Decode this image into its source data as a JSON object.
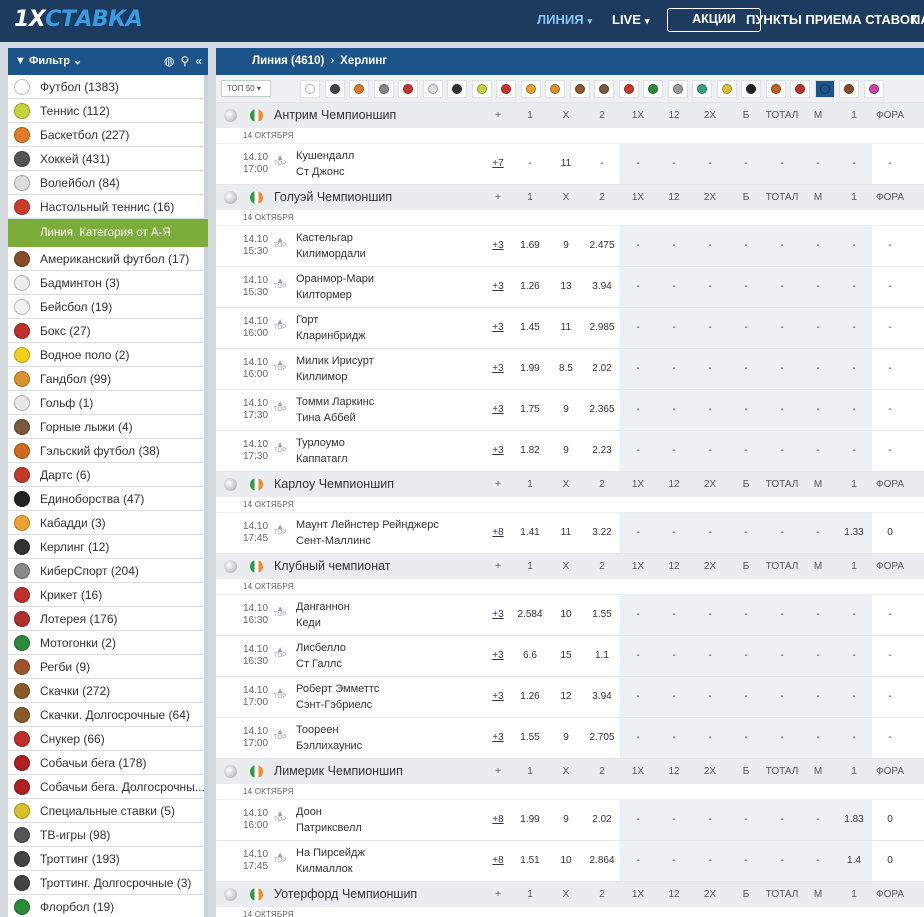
{
  "header": {
    "logo_part1": "1X",
    "logo_part2": "СТАВКА",
    "nav": [
      {
        "label": "ЛИНИЯ",
        "chevron": "▾",
        "active": true
      },
      {
        "label": "LIVE",
        "chevron": "▾",
        "active": false
      }
    ],
    "promo_label": "АКЦИИ",
    "points_label": "ПУНКТЫ ПРИЕМА СТАВОК",
    "cut_label": "ПА"
  },
  "sidebar": {
    "filter_label": "Фильтр",
    "category_label": "Линия. Категория от А-Я",
    "top_sports": [
      {
        "label": "Футбол (1383)",
        "icon": "football-icon",
        "color": "#ffffff"
      },
      {
        "label": "Теннис (112)",
        "icon": "tennis-icon",
        "color": "#c5d43a"
      },
      {
        "label": "Баскетбол (227)",
        "icon": "basketball-icon",
        "color": "#e07b2a"
      },
      {
        "label": "Хоккей (431)",
        "icon": "hockey-icon",
        "color": "#555555"
      },
      {
        "label": "Волейбол (84)",
        "icon": "volleyball-icon",
        "color": "#dddddd"
      },
      {
        "label": "Настольный теннис (16)",
        "icon": "table-tennis-icon",
        "color": "#d03a2a"
      }
    ],
    "sports": [
      {
        "label": "Американский футбол (17)",
        "icon": "american-football-icon",
        "color": "#8a4a26"
      },
      {
        "label": "Бадминтон (3)",
        "icon": "badminton-icon",
        "color": "#eeeeee"
      },
      {
        "label": "Бейсбол (19)",
        "icon": "baseball-icon",
        "color": "#f2f2f2"
      },
      {
        "label": "Бокс (27)",
        "icon": "boxing-icon",
        "color": "#c0302a"
      },
      {
        "label": "Водное поло (2)",
        "icon": "water-polo-icon",
        "color": "#f2d11a"
      },
      {
        "label": "Гандбол (99)",
        "icon": "handball-icon",
        "color": "#d8922e"
      },
      {
        "label": "Гольф (1)",
        "icon": "golf-icon",
        "color": "#e8e8e8"
      },
      {
        "label": "Горные лыжи (4)",
        "icon": "alpine-skiing-icon",
        "color": "#7a5a3a"
      },
      {
        "label": "Гэльский футбол (38)",
        "icon": "gaelic-football-icon",
        "color": "#d06a1e"
      },
      {
        "label": "Дартс (6)",
        "icon": "darts-icon",
        "color": "#c33a2a"
      },
      {
        "label": "Единоборства (47)",
        "icon": "martial-arts-icon",
        "color": "#222222"
      },
      {
        "label": "Кабадди (3)",
        "icon": "kabaddi-icon",
        "color": "#f0a030"
      },
      {
        "label": "Керлинг (12)",
        "icon": "curling-icon",
        "color": "#333333"
      },
      {
        "label": "КиберСпорт (204)",
        "icon": "esports-icon",
        "color": "#888888"
      },
      {
        "label": "Крикет (16)",
        "icon": "cricket-icon",
        "color": "#c0302a"
      },
      {
        "label": "Лотерея (176)",
        "icon": "lottery-icon",
        "color": "#b03030"
      },
      {
        "label": "Мотогонки (2)",
        "icon": "motorsport-icon",
        "color": "#2a8a3a"
      },
      {
        "label": "Регби (9)",
        "icon": "rugby-icon",
        "color": "#a0522d"
      },
      {
        "label": "Скачки (272)",
        "icon": "horse-racing-icon",
        "color": "#8a5a2a"
      },
      {
        "label": "Скачки. Долгосрочные (64)",
        "icon": "horse-racing-long-icon",
        "color": "#8a5a2a"
      },
      {
        "label": "Снукер (66)",
        "icon": "snooker-icon",
        "color": "#c0302a"
      },
      {
        "label": "Собачьи бега (178)",
        "icon": "greyhound-icon",
        "color": "#b02020"
      },
      {
        "label": "Собачьи бега. Долгосрочны...",
        "icon": "greyhound-long-icon",
        "color": "#b02020"
      },
      {
        "label": "Специальные ставки (5)",
        "icon": "special-bets-icon",
        "color": "#d8c02a"
      },
      {
        "label": "ТВ-игры (98)",
        "icon": "tv-games-icon",
        "color": "#555555"
      },
      {
        "label": "Троттинг (193)",
        "icon": "trotting-icon",
        "color": "#444444"
      },
      {
        "label": "Троттинг. Долгосрочные (3)",
        "icon": "trotting-long-icon",
        "color": "#444444"
      },
      {
        "label": "Флорбол (19)",
        "icon": "floorball-icon",
        "color": "#2a8a3a"
      }
    ]
  },
  "main": {
    "breadcrumb": [
      "Линия (4610)",
      "Херлинг"
    ],
    "breadcrumb_sep": "›",
    "top50_label": "ТОП 50 ▾",
    "tab_colors": [
      "#ffffff",
      "#444444",
      "#e07b2a",
      "#888888",
      "#cc3333",
      "#dddddd",
      "#333333",
      "#c5d43a",
      "#d0302a",
      "#e8a030",
      "#d8922e",
      "#8a5a2a",
      "#7a5a3a",
      "#c33a2a",
      "#2a8a3a",
      "#999999",
      "#3aa07a",
      "#d8c02a",
      "#222222",
      "#c06020",
      "#c0302a",
      "#1c5489",
      "#8a4a26",
      "#cc44aa"
    ],
    "columns": [
      "+",
      "1",
      "X",
      "2",
      "1X",
      "12",
      "2X",
      "Б",
      "ТОТАЛ",
      "М",
      "1",
      "ФОРА"
    ],
    "top_label": "TOP",
    "championships": [
      {
        "name": "Антрим Чемпионшип",
        "date": "14 ОКТЯБРЯ",
        "matches": [
          {
            "date": "14.10",
            "time": "17:00",
            "team1": "Кушендалл",
            "team2": "Ст Джонс",
            "more": "+7",
            "odds": [
              "-",
              "11",
              "-",
              "-",
              "-",
              "-",
              "-",
              "-",
              "-",
              "-",
              "-"
            ]
          }
        ]
      },
      {
        "name": "Голуэй Чемпионшип",
        "date": "14 ОКТЯБРЯ",
        "matches": [
          {
            "date": "14.10",
            "time": "15:30",
            "team1": "Кастельгар",
            "team2": "Килимордали",
            "more": "+3",
            "odds": [
              "1.69",
              "9",
              "2.475",
              "-",
              "-",
              "-",
              "-",
              "-",
              "-",
              "-",
              "-"
            ]
          },
          {
            "date": "14.10",
            "time": "15:30",
            "team1": "Оранмор-Мари",
            "team2": "Килтормер",
            "more": "+3",
            "odds": [
              "1.26",
              "13",
              "3.94",
              "-",
              "-",
              "-",
              "-",
              "-",
              "-",
              "-",
              "-"
            ]
          },
          {
            "date": "14.10",
            "time": "16:00",
            "team1": "Горт",
            "team2": "Кларинбридж",
            "more": "+3",
            "odds": [
              "1.45",
              "11",
              "2.985",
              "-",
              "-",
              "-",
              "-",
              "-",
              "-",
              "-",
              "-"
            ]
          },
          {
            "date": "14.10",
            "time": "16:00",
            "team1": "Милик Ирисурт",
            "team2": "Киллимор",
            "more": "+3",
            "odds": [
              "1.99",
              "8.5",
              "2.02",
              "-",
              "-",
              "-",
              "-",
              "-",
              "-",
              "-",
              "-"
            ]
          },
          {
            "date": "14.10",
            "time": "17:30",
            "team1": "Томми Ларкинс",
            "team2": "Тина Аббей",
            "more": "+3",
            "odds": [
              "1.75",
              "9",
              "2.365",
              "-",
              "-",
              "-",
              "-",
              "-",
              "-",
              "-",
              "-"
            ]
          },
          {
            "date": "14.10",
            "time": "17:30",
            "team1": "Турлоумо",
            "team2": "Каппатагл",
            "more": "+3",
            "odds": [
              "1.82",
              "9",
              "2.23",
              "-",
              "-",
              "-",
              "-",
              "-",
              "-",
              "-",
              "-"
            ]
          }
        ]
      },
      {
        "name": "Карлоу Чемпионшип",
        "date": "14 ОКТЯБРЯ",
        "matches": [
          {
            "date": "14.10",
            "time": "17:45",
            "team1": "Маунт Лейнстер Рейнджерс",
            "team2": "Сент-Маллинс",
            "more": "+8",
            "odds": [
              "1.41",
              "11",
              "3.22",
              "-",
              "-",
              "-",
              "-",
              "-",
              "-",
              "1.33",
              "0"
            ]
          }
        ]
      },
      {
        "name": "Клубный чемпионат",
        "date": "14 ОКТЯБРЯ",
        "matches": [
          {
            "date": "14.10",
            "time": "16:30",
            "team1": "Данганнон",
            "team2": "Кеди",
            "more": "+3",
            "odds": [
              "2.584",
              "10",
              "1.55",
              "-",
              "-",
              "-",
              "-",
              "-",
              "-",
              "-",
              "-"
            ]
          },
          {
            "date": "14.10",
            "time": "16:30",
            "team1": "Лисбелло",
            "team2": "Ст Галлс",
            "more": "+3",
            "odds": [
              "6.6",
              "15",
              "1.1",
              "-",
              "-",
              "-",
              "-",
              "-",
              "-",
              "-",
              "-"
            ]
          },
          {
            "date": "14.10",
            "time": "17:00",
            "team1": "Роберт Эмметтс",
            "team2": "Сэнт-Гэбриелс",
            "more": "+3",
            "odds": [
              "1.26",
              "12",
              "3.94",
              "-",
              "-",
              "-",
              "-",
              "-",
              "-",
              "-",
              "-"
            ]
          },
          {
            "date": "14.10",
            "time": "17:00",
            "team1": "Тоореен",
            "team2": "Бэллихаунис",
            "more": "+3",
            "odds": [
              "1.55",
              "9",
              "2.705",
              "-",
              "-",
              "-",
              "-",
              "-",
              "-",
              "-",
              "-"
            ]
          }
        ]
      },
      {
        "name": "Лимерик Чемпионшип",
        "date": "14 ОКТЯБРЯ",
        "matches": [
          {
            "date": "14.10",
            "time": "16:00",
            "team1": "Доон",
            "team2": "Патриксвелл",
            "more": "+8",
            "odds": [
              "1.99",
              "9",
              "2.02",
              "-",
              "-",
              "-",
              "-",
              "-",
              "-",
              "1.83",
              "0"
            ]
          },
          {
            "date": "14.10",
            "time": "17:45",
            "team1": "На Пирсейдж",
            "team2": "Килмаллок",
            "more": "+8",
            "odds": [
              "1.51",
              "10",
              "2.864",
              "-",
              "-",
              "-",
              "-",
              "-",
              "-",
              "1.4",
              "0"
            ]
          }
        ]
      },
      {
        "name": "Уотерфорд Чемпионшип",
        "date": "14 ОКТЯБРЯ",
        "matches": []
      }
    ]
  }
}
